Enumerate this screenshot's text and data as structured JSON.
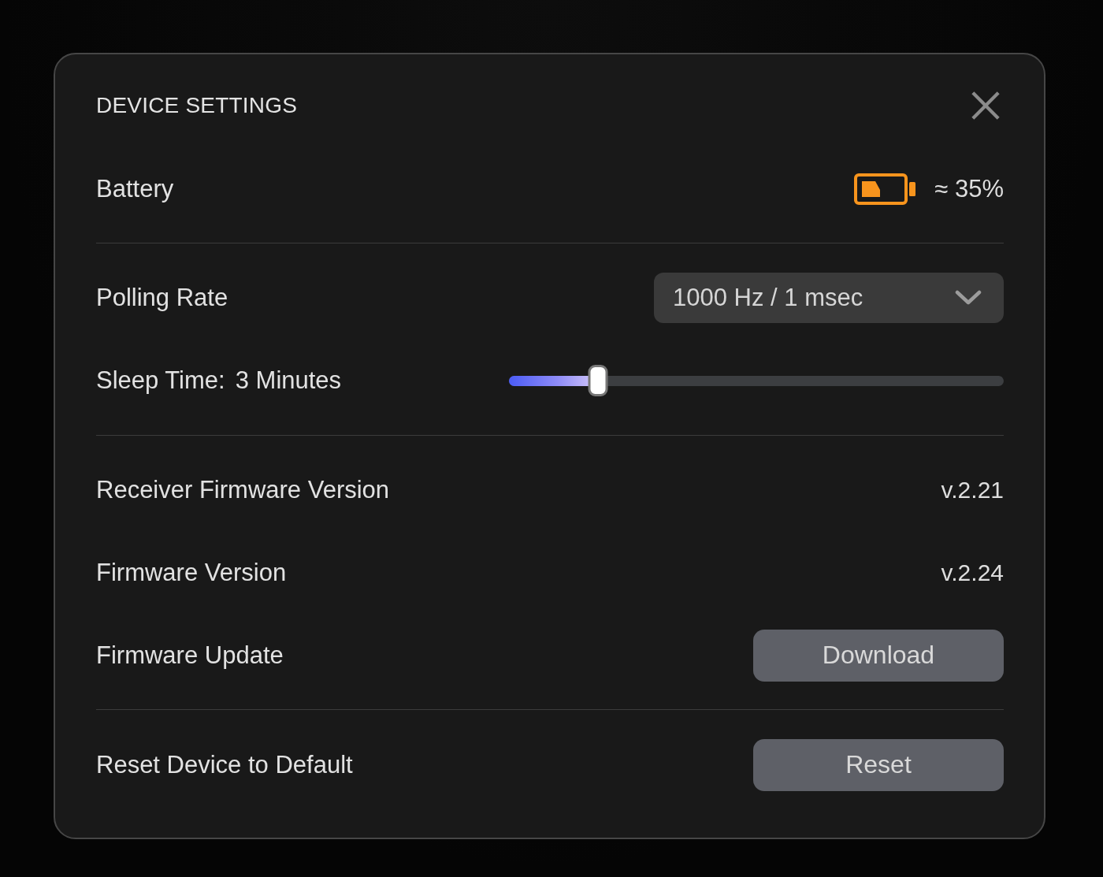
{
  "dialog": {
    "title": "DEVICE SETTINGS"
  },
  "sections": [
    {
      "rows": [
        {
          "kind": "battery",
          "label": "Battery",
          "value": "≈ 35%"
        }
      ]
    },
    {
      "rows": [
        {
          "kind": "dropdown",
          "label": "Polling Rate",
          "value": "1000 Hz / 1 msec"
        },
        {
          "kind": "slider",
          "label": "Sleep Time:",
          "reading": "3 Minutes",
          "level": 0.18
        }
      ]
    },
    {
      "rows": [
        {
          "kind": "text",
          "label": "Receiver Firmware Version",
          "value": "v.2.21"
        },
        {
          "kind": "text",
          "label": "Firmware Version",
          "value": "v.2.24"
        },
        {
          "kind": "button",
          "label": "Firmware Update",
          "button": "Download"
        }
      ]
    },
    {
      "rows": [
        {
          "kind": "button",
          "label": "Reset Device to Default",
          "button": "Reset"
        }
      ]
    }
  ]
}
